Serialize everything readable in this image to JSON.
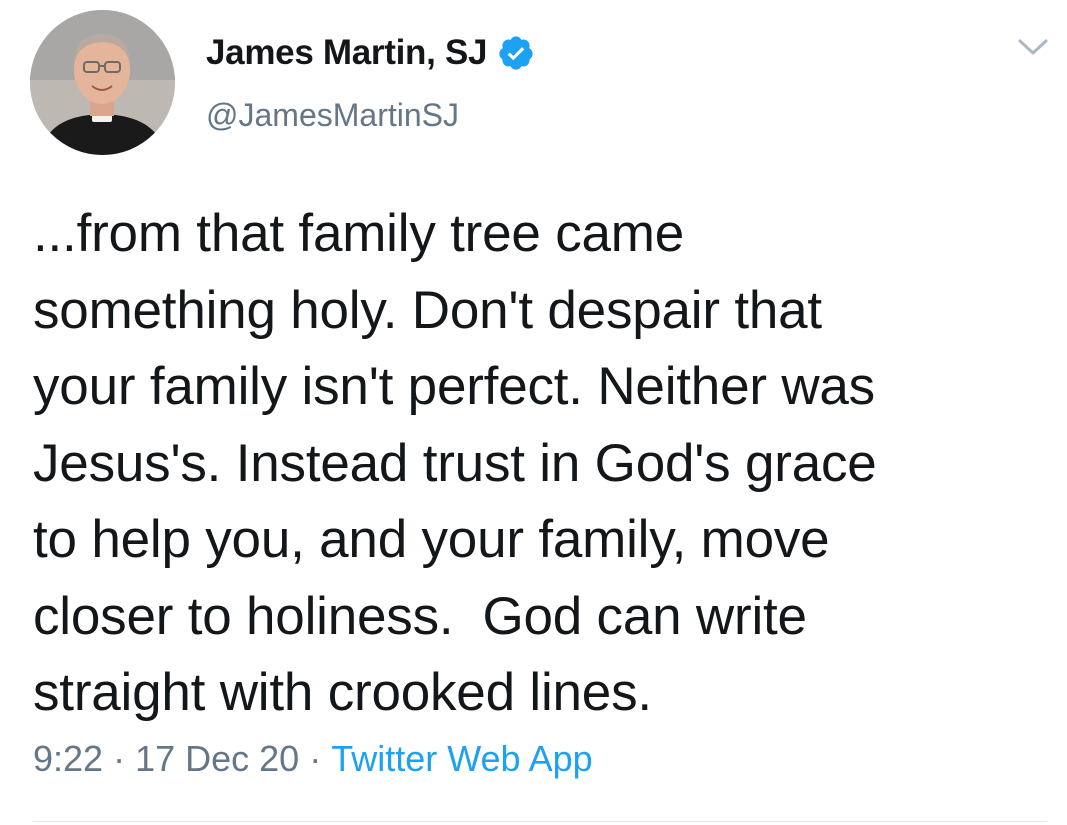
{
  "user": {
    "display_name": "James Martin, SJ",
    "handle": "@JamesMartinSJ",
    "verified": true,
    "avatar_icon": "profile-photo"
  },
  "tweet": {
    "lines": [
      "...from that family tree came",
      "something holy. Don't despair that",
      "your family isn't perfect. Neither was",
      "Jesus's. Instead trust in God's grace",
      "to help you, and your family, move",
      "closer to holiness.  God can write",
      "straight with crooked lines."
    ],
    "time": "9:22",
    "date": "17 Dec 20",
    "separator": "·",
    "source": "Twitter Web App"
  },
  "icons": {
    "verified": "verified-badge-icon",
    "menu": "chevron-down-icon"
  },
  "colors": {
    "text": "#14171a",
    "secondary": "#657786",
    "link": "#1da1f2",
    "verified": "#1da1f2"
  }
}
